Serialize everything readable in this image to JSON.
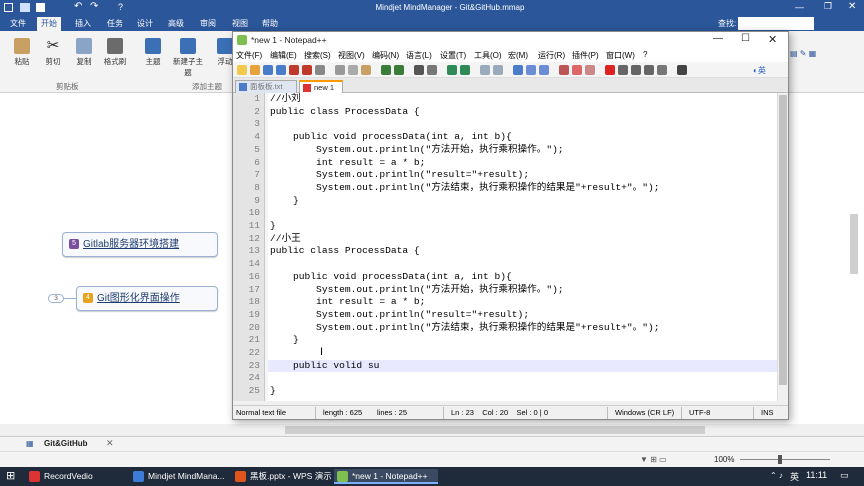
{
  "mindmanager": {
    "title": "Mindjet MindManager - Git&GitHub.mmap",
    "tabs": [
      "文件",
      "开始",
      "插入",
      "任务",
      "设计",
      "高级",
      "审阅",
      "视图",
      "帮助"
    ],
    "active_tab": "开始",
    "search_label": "查找:",
    "ribbon": [
      {
        "label": "粘贴"
      },
      {
        "label": "剪切"
      },
      {
        "label": "复制"
      },
      {
        "label": "格式刷"
      },
      {
        "label": "主题"
      },
      {
        "label": "新建子主题"
      },
      {
        "label": "浮动"
      }
    ],
    "groups": {
      "clipboard": "剪贴板",
      "add_topic": "添加主题"
    },
    "nodes": [
      {
        "badge": "5",
        "text": "Gitlab服务器环境搭建",
        "badge_color": "#7b4fa0"
      },
      {
        "badge": "4",
        "text": "Git图形化界面操作",
        "badge_color": "#e8a31c"
      }
    ],
    "collapsed_count": "3",
    "doc_tab": "Git&GitHub",
    "zoom": "100%"
  },
  "notepad": {
    "title": "*new 1 - Notepad++",
    "menu": [
      "文件(F)",
      "编辑(E)",
      "搜索(S)",
      "视图(V)",
      "编码(N)",
      "语言(L)",
      "设置(T)",
      "工具(O)",
      "宏(M)",
      "运行(R)",
      "插件(P)",
      "窗口(W)",
      "?"
    ],
    "tabs": [
      {
        "label": "面板板.txt",
        "active": false
      },
      {
        "label": "new 1",
        "active": true
      }
    ],
    "lines": [
      {
        "n": "1",
        "text": "//小刘"
      },
      {
        "n": "2",
        "text": "public class ProcessData {"
      },
      {
        "n": "3",
        "text": ""
      },
      {
        "n": "4",
        "text": "    public void processData(int a, int b){"
      },
      {
        "n": "5",
        "text": "        System.out.println(\"方法开始，执行乘积操作。\");"
      },
      {
        "n": "6",
        "text": "        int result = a * b;"
      },
      {
        "n": "7",
        "text": "        System.out.println(\"result=\"+result);"
      },
      {
        "n": "8",
        "text": "        System.out.println(\"方法结束，执行乘积操作的结果是\"+result+\"。\");"
      },
      {
        "n": "9",
        "text": "    }"
      },
      {
        "n": "10",
        "text": ""
      },
      {
        "n": "11",
        "text": "}"
      },
      {
        "n": "12",
        "text": "//小王"
      },
      {
        "n": "13",
        "text": "public class ProcessData {"
      },
      {
        "n": "14",
        "text": ""
      },
      {
        "n": "16",
        "text": "    public void processData(int a, int b){"
      },
      {
        "n": "17",
        "text": "        System.out.println(\"方法开始，执行乘积操作。\");"
      },
      {
        "n": "18",
        "text": "        int result = a * b;"
      },
      {
        "n": "19",
        "text": "        System.out.println(\"result=\"+result);"
      },
      {
        "n": "20",
        "text": "        System.out.println(\"方法结束，执行乘积操作的结果是\"+result+\"。\");"
      },
      {
        "n": "21",
        "text": "    }"
      },
      {
        "n": "22",
        "text": ""
      },
      {
        "n": "23",
        "text": "    public volid su"
      },
      {
        "n": "24",
        "text": ""
      },
      {
        "n": "25",
        "text": "}"
      }
    ],
    "current_line": "23",
    "status": {
      "type": "Normal text file",
      "length": "length : 625",
      "lines": "lines : 25",
      "pos": "Ln : 23    Col : 20    Sel : 0 | 0",
      "eol": "Windows (CR LF)",
      "enc": "UTF-8",
      "mode": "INS"
    }
  },
  "taskbar": {
    "items": [
      {
        "label": "RecordVedio",
        "color": "#d33"
      },
      {
        "label": "Mindjet MindMana...",
        "color": "#3c7bd6"
      },
      {
        "label": "黑板.pptx - WPS 演示",
        "color": "#e0551e"
      },
      {
        "label": "*new 1 - Notepad++",
        "color": "#7fbf4f"
      }
    ],
    "ime": "英",
    "time": "11:11"
  }
}
